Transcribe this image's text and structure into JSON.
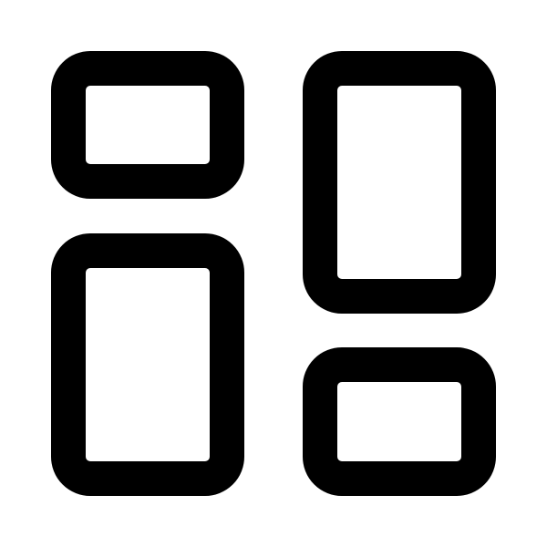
{
  "icon": {
    "name": "dashboard-layout-icon",
    "stroke_color": "#000000",
    "background_color": "#ffffff",
    "tiles": [
      {
        "name": "tile-top-left"
      },
      {
        "name": "tile-bottom-left"
      },
      {
        "name": "tile-top-right"
      },
      {
        "name": "tile-bottom-right"
      }
    ]
  }
}
